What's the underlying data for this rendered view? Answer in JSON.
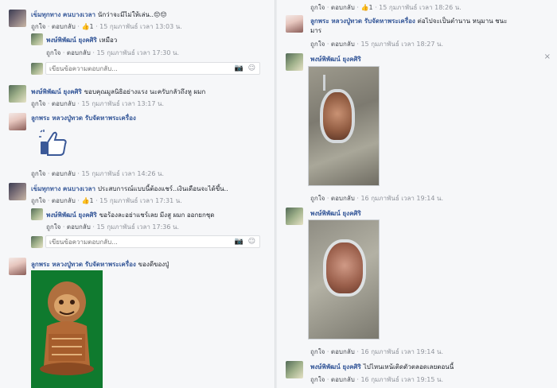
{
  "left": {
    "c1": {
      "name": "เข็มทุกทาง ฅนบางเวลา",
      "text": "นักว่าจะมีไม่ให้เล่น..😔😔",
      "like": "ถูกใจ",
      "reply": "ตอบกลับ",
      "likes": "1",
      "time": "15 กุมภาพันธ์ เวลา 13:03 น."
    },
    "c1r": {
      "name": "พงษ์พิพัฒน์ ยุงคศิริ",
      "text": "เหมือว",
      "like": "ถูกใจ",
      "reply": "ตอบกลับ",
      "time": "15 กุมภาพันธ์ เวลา 17:30 น."
    },
    "box1": {
      "placeholder": "เขียนข้อความตอบกลับ..."
    },
    "c2": {
      "name": "พงษ์พิพัฒน์ ยุงคศิริ",
      "text": "ขอบคุณมูลนิธิอย่างแรง นะครับกลัวถึงหู ผมก",
      "like": "ถูกใจ",
      "reply": "ตอบกลับ",
      "time": "15 กุมภาพันธ์ เวลา 13:17 น."
    },
    "c3": {
      "name": "ลูกพระ หลวงปู่ทวด รับจัดหาพระเครื่อง",
      "like": "ถูกใจ",
      "reply": "ตอบกลับ",
      "time": "15 กุมภาพันธ์ เวลา 14:26 น."
    },
    "c4": {
      "name": "เข็มทุกทาง ฅนบางเวลา",
      "text": "ประสบการณ์แบบนี้ต้องแชร์..เงินเดือนจะได้ขึ้น..",
      "like": "ถูกใจ",
      "reply": "ตอบกลับ",
      "likes": "1",
      "time": "15 กุมภาพันธ์ เวลา 17:31 น."
    },
    "c4r": {
      "name": "พงษ์พิพัฒน์ ยุงคศิริ",
      "text": "ขอร้องละอย่าแชร์เลย มีงสู ผมก ออกยกชุด",
      "like": "ถูกใจ",
      "reply": "ตอบกลับ",
      "time": "15 กุมภาพันธ์ เวลา 17:36 น."
    },
    "box2": {
      "placeholder": "เขียนข้อความตอบกลับ..."
    },
    "c5": {
      "name": "ลูกพระ หลวงปู่ทวด รับจัดหาพระเครื่อง",
      "text": "ของดีของปู่"
    }
  },
  "right": {
    "top": {
      "like": "ถูกใจ",
      "reply": "ตอบกลับ",
      "likes": "1",
      "time": "15 กุมภาพันธ์ เวลา 18:26 น."
    },
    "c1": {
      "name": "ลูกพระ หลวงปู่ทวด รับจัดหาพระเครื่อง",
      "text": "ต่อไปจะเป็นตำนาน หนุมาน ชนะ",
      "text2": "มาร",
      "like": "ถูกใจ",
      "reply": "ตอบกลับ",
      "time": "15 กุมภาพันธ์ เวลา 18:27 น."
    },
    "c2": {
      "name": "พงษ์พิพัฒน์ ยุงคศิริ",
      "like": "ถูกใจ",
      "reply": "ตอบกลับ",
      "time": "16 กุมภาพันธ์ เวลา 19:14 น."
    },
    "c3": {
      "name": "พงษ์พิพัฒน์ ยุงคศิริ",
      "like": "ถูกใจ",
      "reply": "ตอบกลับ",
      "time": "16 กุมภาพันธ์ เวลา 19:14 น."
    },
    "c4": {
      "name": "พงษ์พิพัฒน์ ยุงคศิริ",
      "text": "ไปไหนเหน้เติดตัวตลอดเลยตอนนี้",
      "like": "ถูกใจ",
      "reply": "ตอบกลับ",
      "time": "16 กุมภาพันธ์ เวลา 19:15 น."
    },
    "close": "×"
  },
  "icons": {
    "like": "thumbs-up-icon",
    "camera": "camera-icon",
    "emoji": "smiley-icon"
  },
  "colors": {
    "link": "#365899",
    "meta": "#90949c",
    "like": "#4267b2",
    "bg": "#f6f7f9"
  }
}
